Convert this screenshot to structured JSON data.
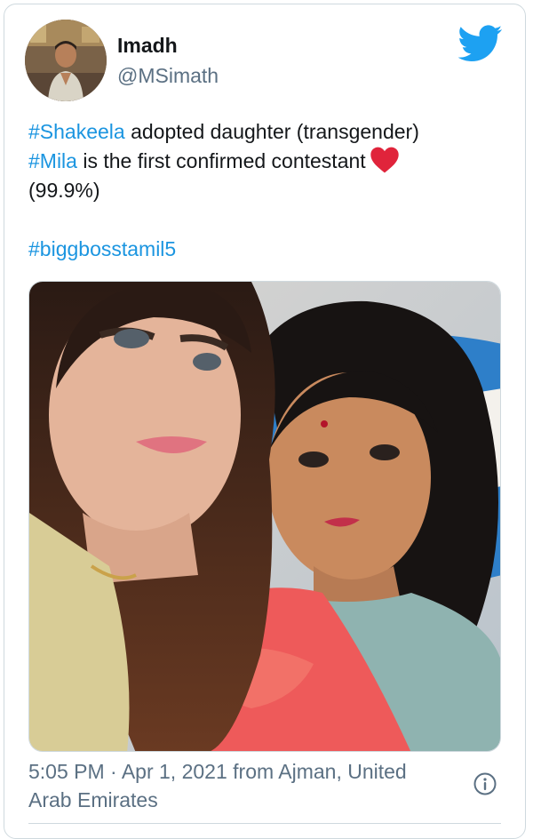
{
  "author": {
    "name": "Imadh",
    "handle": "@MSimath"
  },
  "tweet": {
    "line1_tag": "#Shakeela",
    "line1_text": " adopted daughter (transgender)",
    "line2_tag": "#Mila",
    "line2_text": " is the first confirmed contestant",
    "line3_text": "(99.9%)",
    "hashtag_line": "#biggbosstamil5"
  },
  "meta": {
    "time": "5:05 PM",
    "separator": " · ",
    "date": "Apr 1, 2021",
    "location_prefix": " from ",
    "location_line1": "Ajman, United",
    "location_line2": "Arab Emirates"
  },
  "icons": {
    "logo": "twitter-bird-icon",
    "reaction": "red-heart-icon",
    "info": "info-icon"
  },
  "colors": {
    "hashtag": "#1b95e0",
    "twitter_blue": "#1da1f2",
    "secondary_text": "#5b7083",
    "heart": "#e0243b"
  }
}
